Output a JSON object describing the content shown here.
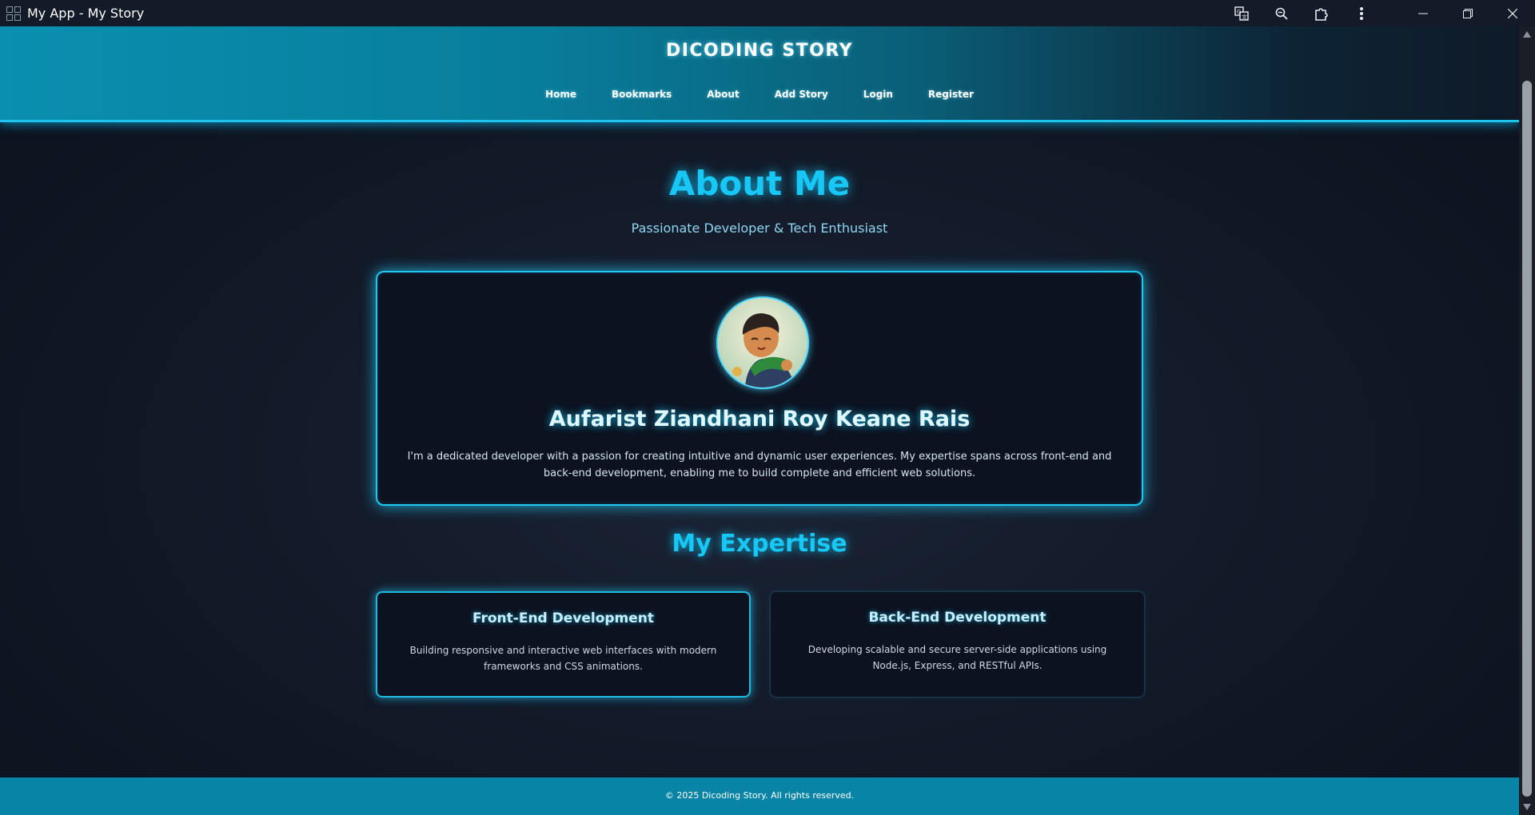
{
  "window": {
    "title": "My App - My Story",
    "icons": [
      "translate-icon",
      "zoom-icon",
      "extensions-icon",
      "more-options-icon"
    ],
    "controls": [
      "minimize-icon",
      "restore-icon",
      "close-icon"
    ]
  },
  "header": {
    "site_title": "DICODING STORY",
    "nav": [
      "Home",
      "Bookmarks",
      "About",
      "Add Story",
      "Login",
      "Register"
    ]
  },
  "about": {
    "title": "About Me",
    "subtitle": "Passionate Developer & Tech Enthusiast",
    "name": "Aufarist Ziandhani Roy Keane Rais",
    "bio": "I'm a dedicated developer with a passion for creating intuitive and dynamic user experiences. My expertise spans across front-end and back-end development, enabling me to build complete and efficient web solutions."
  },
  "expertise": {
    "title": "My Expertise",
    "cards": [
      {
        "title": "Front-End Development",
        "text": "Building responsive and interactive web interfaces with modern frameworks and CSS animations."
      },
      {
        "title": "Back-End Development",
        "text": "Developing scalable and secure server-side applications using Node.js, Express, and RESTful APIs."
      }
    ]
  },
  "footer": {
    "text": "© 2025 Dicoding Story. All rights reserved."
  },
  "colors": {
    "accent": "#17c7f5",
    "header": "#0a8fb0",
    "footer": "#0884a6",
    "card_bg": "#0c1220",
    "page_bg": "#111826"
  }
}
